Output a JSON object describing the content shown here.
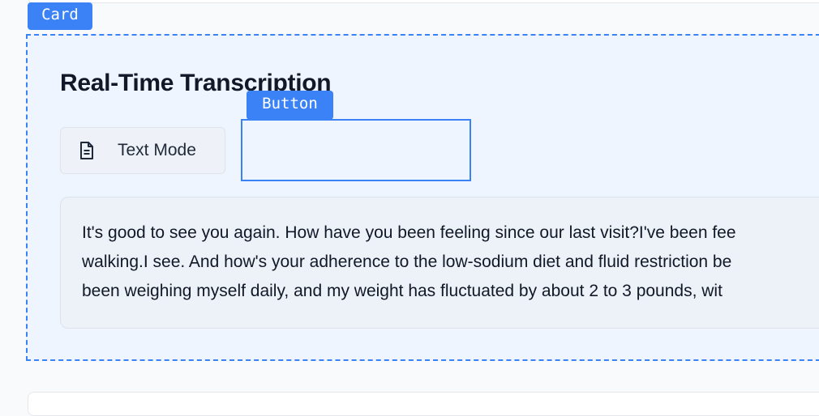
{
  "tags": {
    "card": "Card",
    "button": "Button"
  },
  "card": {
    "title": "Real-Time Transcription",
    "mode_button": {
      "icon": "document-icon",
      "label": "Text Mode"
    },
    "empty_button_label": "",
    "transcript": {
      "lines": [
        "It's good to see you again. How have you been feeling since our last visit?I've been fee",
        "walking.I see. And how's your adherence to the low-sodium diet and fluid restriction be",
        "been weighing myself daily, and my weight has fluctuated by about 2 to 3 pounds, wit"
      ]
    }
  },
  "colors": {
    "accent": "#3b82f6",
    "card_bg": "#eff5ff",
    "transcript_bg": "#edf1f8"
  }
}
